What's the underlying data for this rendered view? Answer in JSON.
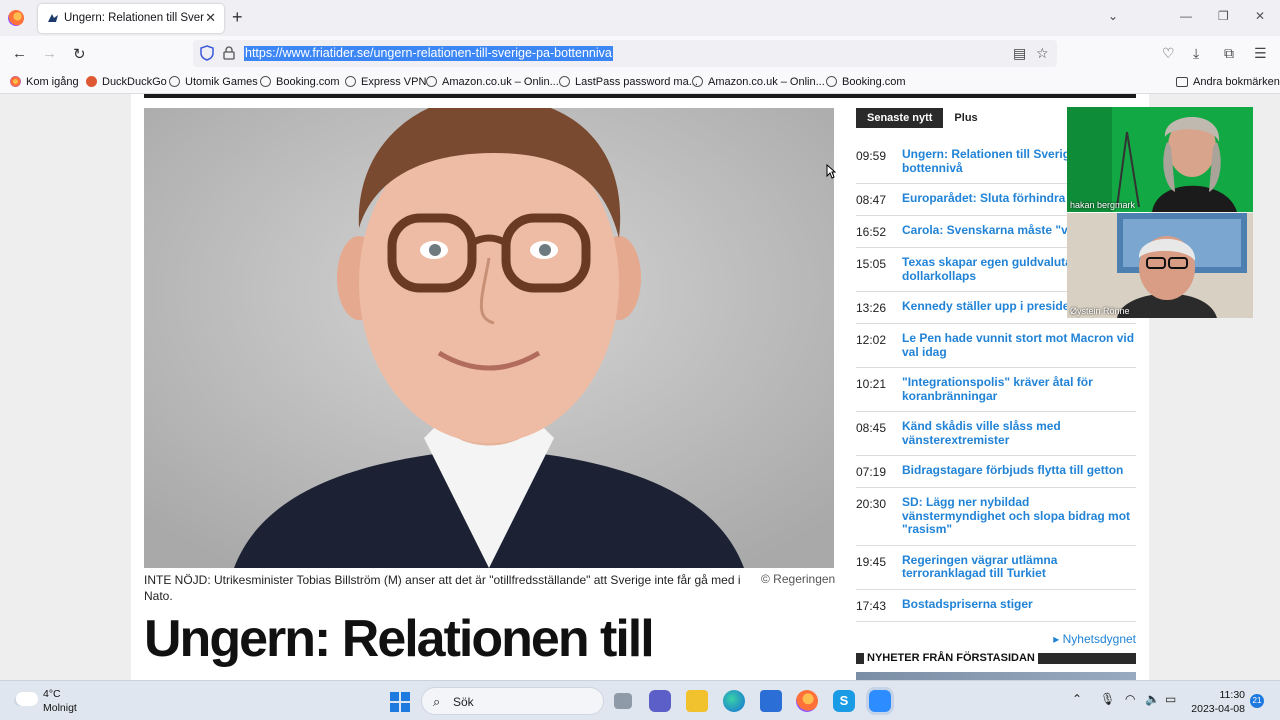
{
  "browser": {
    "tab_title": "Ungern: Relationen till Sverige på bottennivå",
    "url": "https://www.friatider.se/ungern-relationen-till-sverige-pa-bottenniva"
  },
  "bookmarks": [
    {
      "label": "Kom igång",
      "icon": "firefox-icon"
    },
    {
      "label": "DuckDuckGo",
      "icon": "duckduckgo-icon"
    },
    {
      "label": "Utomik Games",
      "icon": "globe-icon"
    },
    {
      "label": "Booking.com",
      "icon": "globe-icon"
    },
    {
      "label": "Express VPN",
      "icon": "globe-icon"
    },
    {
      "label": "Amazon.co.uk – Onlin...",
      "icon": "globe-icon"
    },
    {
      "label": "LastPass password ma...",
      "icon": "globe-icon"
    },
    {
      "label": "Amazon.co.uk – Onlin...",
      "icon": "globe-icon"
    },
    {
      "label": "Booking.com",
      "icon": "globe-icon"
    }
  ],
  "other_bookmarks": "Andra bokmärken",
  "article": {
    "caption": "INTE NÖJD: Utrikesminister Tobias Billström (M) anser att det är \"otillfredsställande\" att Sverige inte får gå med i Nato.",
    "credit": "© Regeringen",
    "headline": "Ungern: Relationen till"
  },
  "sidebar": {
    "tabs": [
      "Senaste nytt",
      "Plus"
    ],
    "news": [
      {
        "time": "09:59",
        "title": "Ungern: Relationen till Sverige på bottennivå"
      },
      {
        "time": "08:47",
        "title": "Europarådet: Sluta förhindra invandring"
      },
      {
        "time": "16:52",
        "title": "Carola: Svenskarna måste \"vakna\""
      },
      {
        "time": "15:05",
        "title": "Texas skapar egen guldvaluta mot dollarkollaps"
      },
      {
        "time": "13:26",
        "title": "Kennedy ställer upp i presidentvalet"
      },
      {
        "time": "12:02",
        "title": "Le Pen hade vunnit stort mot Macron vid val idag"
      },
      {
        "time": "10:21",
        "title": "\"Integrationspolis\" kräver åtal för koranbränningar"
      },
      {
        "time": "08:45",
        "title": "Känd skådis ville slåss med vänsterextremister"
      },
      {
        "time": "07:19",
        "title": "Bidragstagare förbjuds flytta till getton"
      },
      {
        "time": "20:30",
        "title": "SD: Lägg ner nybildad vänstermyndighet och slopa bidrag mot \"rasism\""
      },
      {
        "time": "19:45",
        "title": "Regeringen vägrar utlämna terroranklagad till Turkiet"
      },
      {
        "time": "17:43",
        "title": "Bostadspriserna stiger"
      }
    ],
    "more_link": "▸ Nyhetsdygnet",
    "section_title": "NYHETER FRÅN FÖRSTASIDAN"
  },
  "video_call": {
    "participant1": "hakan bergmark",
    "participant2": "Øystein Rönne"
  },
  "taskbar": {
    "temperature": "4°C",
    "condition": "Molnigt",
    "search_label": "Sök",
    "time": "11:30",
    "date": "2023-04-08",
    "notification_count": "21"
  },
  "colors": {
    "link": "#2183d6",
    "url_highlight": "#3c86f5",
    "tab_active": "#2a2a2a"
  }
}
